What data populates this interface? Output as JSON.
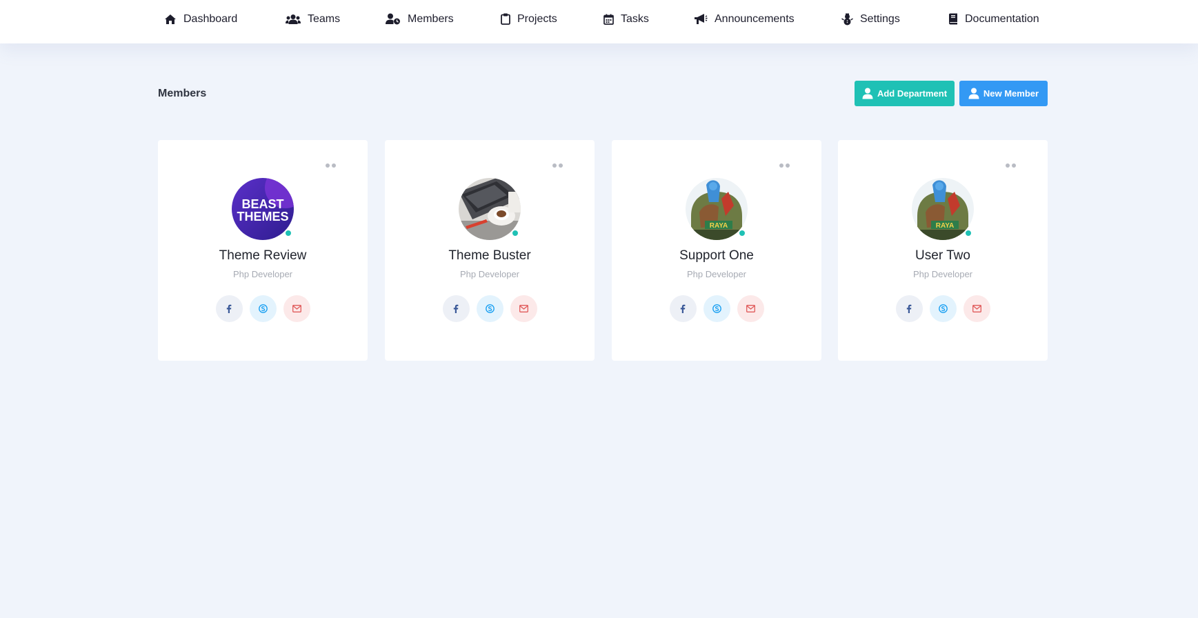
{
  "nav": {
    "items": [
      {
        "label": "Dashboard",
        "icon": "home-icon"
      },
      {
        "label": "Teams",
        "icon": "users-icon"
      },
      {
        "label": "Members",
        "icon": "user-clock-icon"
      },
      {
        "label": "Projects",
        "icon": "clipboard-icon"
      },
      {
        "label": "Tasks",
        "icon": "calendar-icon"
      },
      {
        "label": "Announcements",
        "icon": "bullhorn-icon"
      },
      {
        "label": "Settings",
        "icon": "snowman-icon"
      },
      {
        "label": "Documentation",
        "icon": "book-icon"
      }
    ]
  },
  "header": {
    "title": "Members",
    "add_department_label": "Add Department",
    "new_member_label": "New Member"
  },
  "colors": {
    "page_bg": "#f0f4fb",
    "teal": "#1fc1b5",
    "blue": "#3399f4",
    "online": "#1fc1b5",
    "facebook": "#3b5998",
    "skype": "#1da1f2",
    "mail": "#e05a5a"
  },
  "members": [
    {
      "name": "Theme Review",
      "role": "Php Developer",
      "avatar": "beast-themes-logo",
      "avatar_text_line1": "BEAST",
      "avatar_text_line2": "THEMES"
    },
    {
      "name": "Theme Buster",
      "role": "Php Developer",
      "avatar": "laptop-coffee-photo"
    },
    {
      "name": "Support One",
      "role": "Php Developer",
      "avatar": "raya-poster"
    },
    {
      "name": "User Two",
      "role": "Php Developer",
      "avatar": "raya-poster"
    }
  ]
}
